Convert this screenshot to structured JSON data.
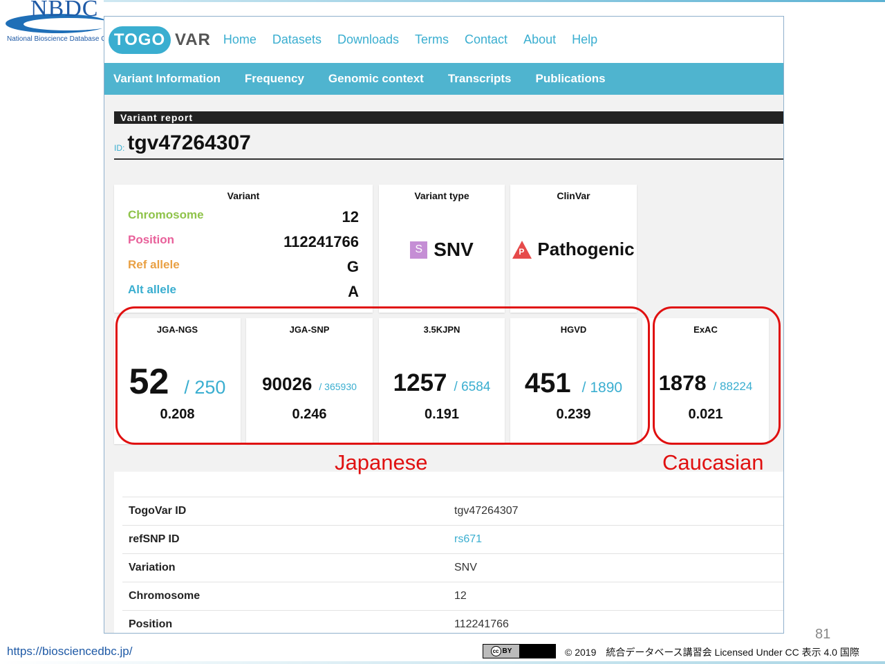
{
  "nbdc": {
    "logo_text": "NBDC",
    "subtitle": "National Bioscience Database Center"
  },
  "app": {
    "logo_left": "TOGO",
    "logo_right": "VAR",
    "nav": [
      "Home",
      "Datasets",
      "Downloads",
      "Terms",
      "Contact",
      "About",
      "Help"
    ],
    "subnav": [
      "Variant Information",
      "Frequency",
      "Genomic context",
      "Transcripts",
      "Publications"
    ]
  },
  "report": {
    "section_title": "Variant report",
    "id_label": "ID:",
    "id_value": "tgv47264307"
  },
  "variant_card": {
    "title": "Variant",
    "rows": [
      {
        "key": "Chromosome",
        "value": "12",
        "color": "#8fc34a"
      },
      {
        "key": "Position",
        "value": "112241766",
        "color": "#e8609a"
      },
      {
        "key": "Ref allele",
        "value": "G",
        "color": "#e9a043"
      },
      {
        "key": "Alt allele",
        "value": "A",
        "color": "#3aaed0"
      }
    ]
  },
  "variant_type_card": {
    "title": "Variant type",
    "badge": "S",
    "value": "SNV"
  },
  "clinvar_card": {
    "title": "ClinVar",
    "badge": "P",
    "value": "Pathogenic"
  },
  "frequencies": [
    {
      "name": "JGA-NGS",
      "count": "52",
      "total": "/ 250",
      "freq": "0.208"
    },
    {
      "name": "JGA-SNP",
      "count": "90026",
      "total": "/ 365930",
      "freq": "0.246"
    },
    {
      "name": "3.5KJPN",
      "count": "1257",
      "total": "/ 6584",
      "freq": "0.191"
    },
    {
      "name": "HGVD",
      "count": "451",
      "total": "/ 1890",
      "freq": "0.239"
    },
    {
      "name": "ExAC",
      "count": "1878",
      "total": "/ 88224",
      "freq": "0.021"
    }
  ],
  "annotations": {
    "japanese": "Japanese",
    "caucasian": "Caucasian"
  },
  "details_table": [
    {
      "key": "TogoVar ID",
      "value": "tgv47264307",
      "link": false
    },
    {
      "key": "refSNP ID",
      "value": "rs671",
      "link": true
    },
    {
      "key": "Variation",
      "value": "SNV",
      "link": false
    },
    {
      "key": "Chromosome",
      "value": "12",
      "link": false
    },
    {
      "key": "Position",
      "value": "112241766",
      "link": false
    }
  ],
  "footer": {
    "url": "https://biosciencedbc.jp/",
    "page_number": "81",
    "cc_badge": "BY",
    "license": "© 2019　統合データベース講習会 Licensed Under CC 表示 4.0 国際"
  }
}
